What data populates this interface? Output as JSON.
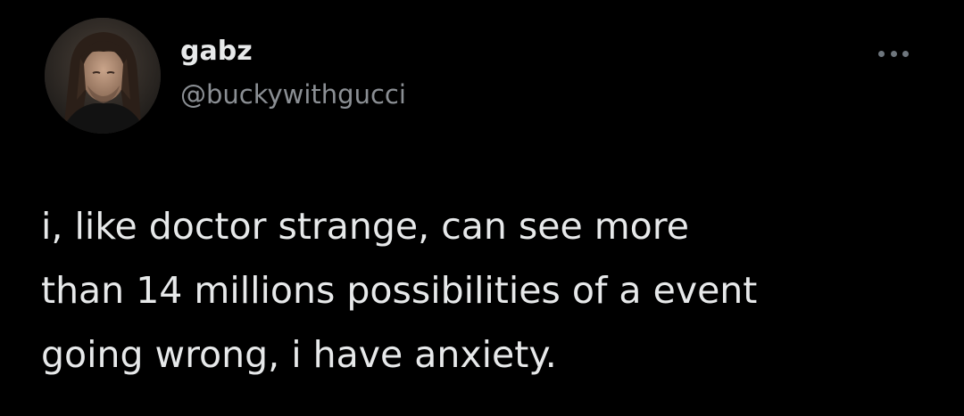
{
  "tweet": {
    "author_name": "gabz",
    "author_handle": "@buckywithgucci",
    "text_lines": [
      "i, like doctor strange, can see more",
      "than 14 millions possibilities of a event",
      "going wrong, i have anxiety."
    ]
  },
  "colors": {
    "background": "#000000",
    "text": "#e7e9ea",
    "handle": "#8b8f94",
    "more_icon": "#6e767d"
  },
  "icons": {
    "more": "more-horizontal-icon"
  }
}
